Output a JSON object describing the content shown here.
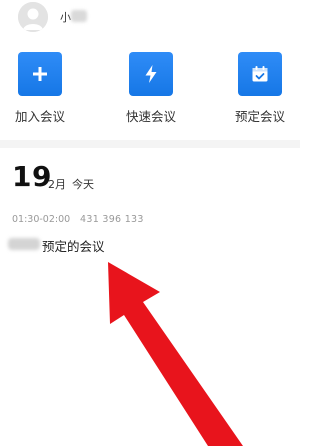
{
  "user": {
    "name": "小"
  },
  "actions": [
    {
      "label": "加入会议",
      "icon": "plus-icon"
    },
    {
      "label": "快速会议",
      "icon": "lightning-icon"
    },
    {
      "label": "预定会议",
      "icon": "calendar-check-icon"
    }
  ],
  "date": {
    "day": "19",
    "month": "2月",
    "today": "今天"
  },
  "meeting": {
    "time": "01:30-02:00",
    "id": "431 396 133",
    "title": "预定的会议"
  },
  "colors": {
    "accent": "#1677e6",
    "arrow": "#e8141c"
  }
}
